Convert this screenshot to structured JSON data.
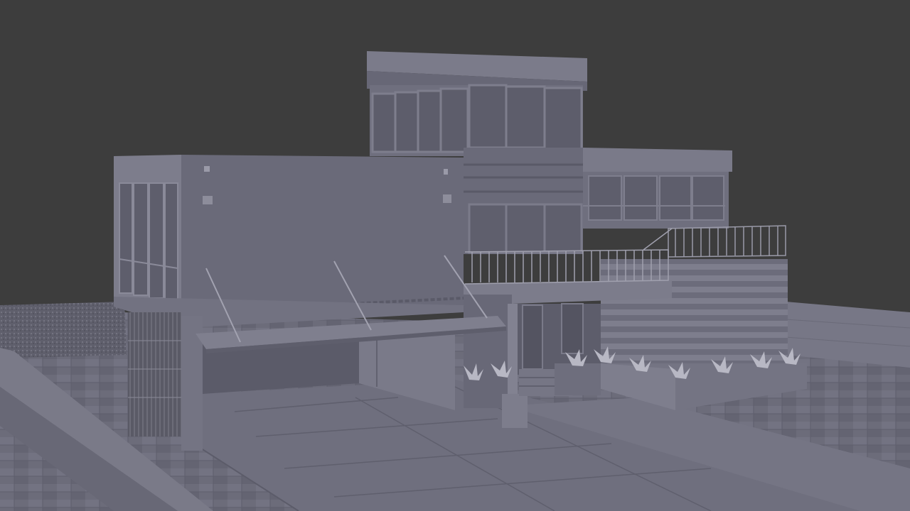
{
  "viewport": {
    "background_color": "#3d3d3d",
    "scene_description_visible_text": "",
    "model_color": "#6e6e7e",
    "light_face_color": "#7c7c8c",
    "dark_face_color": "#5a5a68",
    "shadow_color": "#4f4f5c",
    "ground_color": "#6a6a78",
    "line_color": "#8a8a98"
  }
}
